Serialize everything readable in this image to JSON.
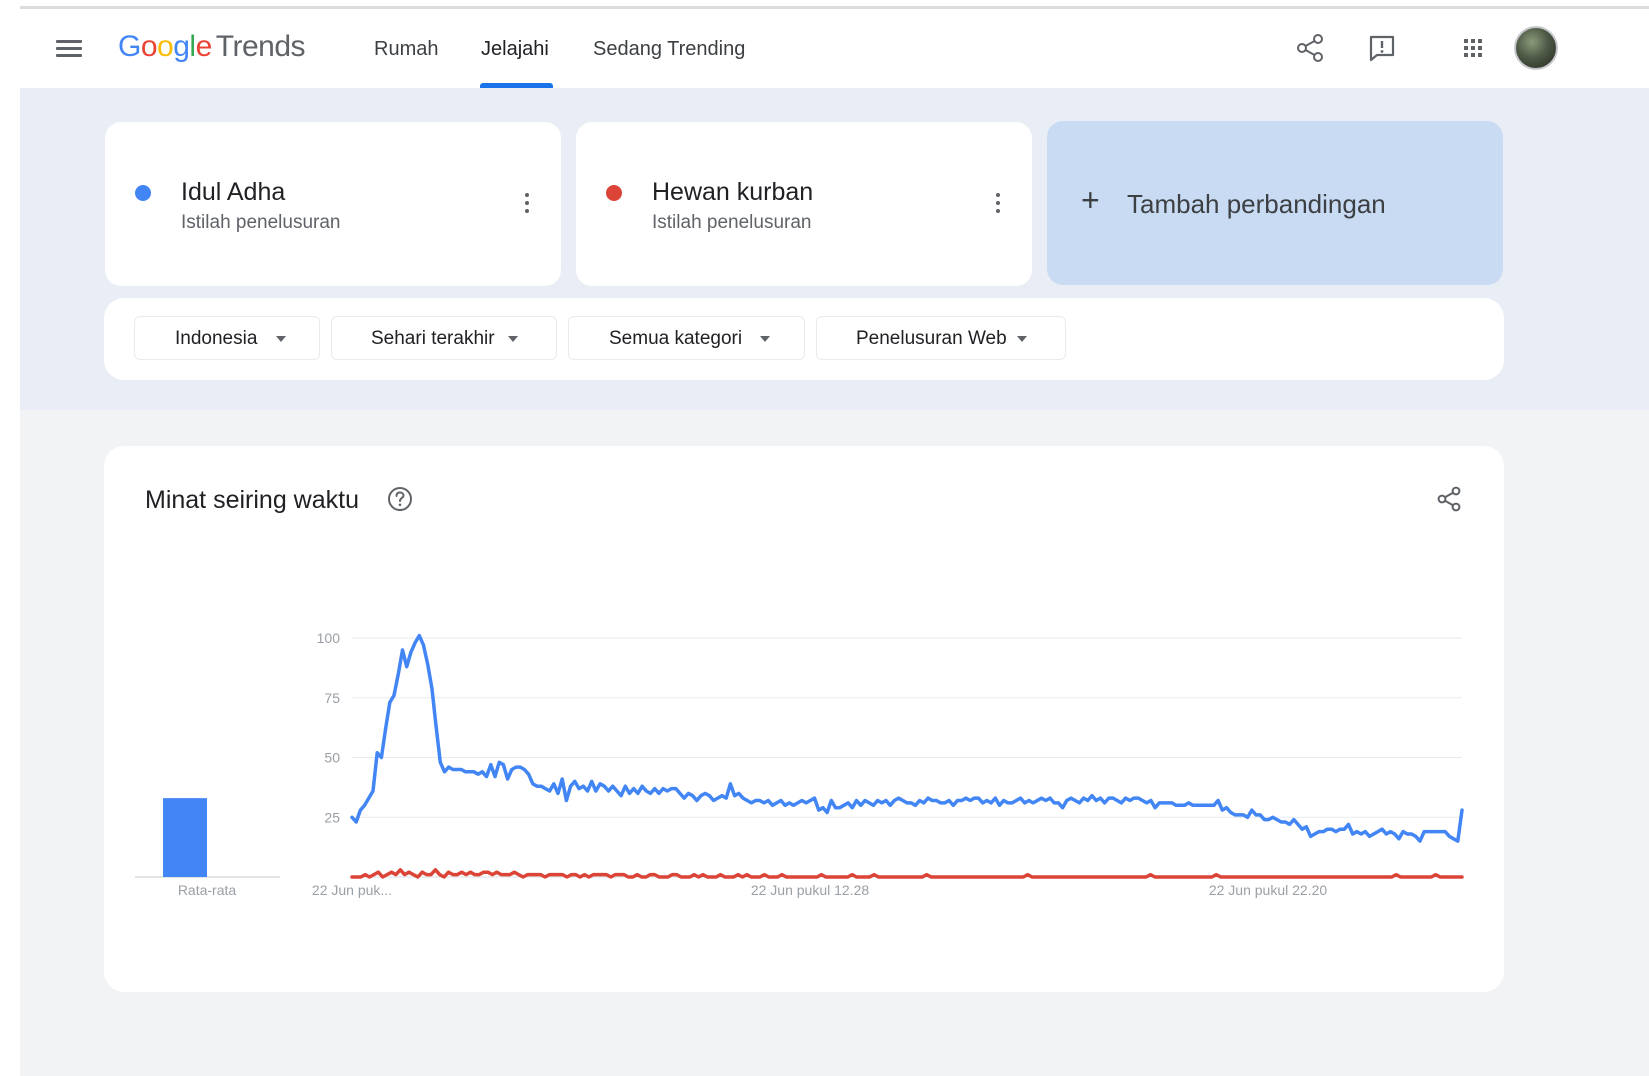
{
  "header": {
    "logo": {
      "google": [
        "G",
        "o",
        "o",
        "g",
        "l",
        "e"
      ],
      "trends": "Trends"
    },
    "nav": [
      {
        "label": "Rumah",
        "active": false
      },
      {
        "label": "Jelajahi",
        "active": true
      },
      {
        "label": "Sedang Trending",
        "active": false
      }
    ],
    "icons": [
      "menu-icon",
      "share-icon",
      "feedback-icon",
      "apps-grid-icon",
      "avatar"
    ]
  },
  "terms": [
    {
      "label": "Idul Adha",
      "sub": "Istilah penelusuran",
      "color": "#4285f4"
    },
    {
      "label": "Hewan kurban",
      "sub": "Istilah penelusuran",
      "color": "#db4437"
    }
  ],
  "add_compare": {
    "label": "Tambah perbandingan"
  },
  "filters": {
    "region": "Indonesia",
    "time": "Sehari terakhir",
    "category": "Semua kategori",
    "source": "Penelusuran Web"
  },
  "chart_card": {
    "title": "Minat seiring waktu"
  },
  "chart_data": [
    {
      "type": "bar",
      "categories": [
        "Rata-rata"
      ],
      "series": [
        {
          "name": "Idul Adha",
          "color": "#4285f4",
          "values": [
            33
          ]
        },
        {
          "name": "Hewan kurban",
          "color": "#db4437",
          "values": [
            0
          ]
        }
      ]
    },
    {
      "type": "line",
      "ylim": [
        0,
        100
      ],
      "yticks": [
        25,
        50,
        75,
        100
      ],
      "grid": true,
      "xtick_labels": [
        "22 Jun puk...",
        "22 Jun pukul 12.28",
        "22 Jun pukul 22.20"
      ],
      "series": [
        {
          "name": "Idul Adha",
          "color": "#4285f4",
          "values": [
            25,
            23,
            28,
            30,
            33,
            36,
            52,
            50,
            62,
            73,
            76,
            85,
            95,
            88,
            94,
            98,
            101,
            97,
            89,
            79,
            63,
            48,
            44,
            46,
            45,
            45,
            45,
            44,
            44,
            44,
            43,
            44,
            42,
            47,
            42,
            48,
            47,
            41,
            45,
            46,
            46,
            45,
            43,
            39,
            38,
            38,
            37,
            36,
            39,
            35,
            41,
            32,
            38,
            40,
            37,
            38,
            36,
            40,
            36,
            39,
            38,
            36,
            38,
            36,
            34,
            38,
            35,
            37,
            35,
            38,
            36,
            35,
            37,
            35,
            37,
            36,
            37,
            37,
            35,
            33,
            35,
            34,
            32,
            34,
            35,
            34,
            32,
            33,
            34,
            33,
            39,
            34,
            35,
            33,
            32,
            31,
            32,
            32,
            31,
            32,
            30,
            31,
            32,
            30,
            31,
            30,
            31,
            32,
            31,
            32,
            33,
            28,
            29,
            27,
            32,
            29,
            29,
            30,
            31,
            29,
            32,
            30,
            32,
            31,
            30,
            32,
            31,
            32,
            30,
            32,
            33,
            32,
            31,
            31,
            30,
            32,
            31,
            33,
            32,
            32,
            31,
            31,
            32,
            30,
            32,
            32,
            33,
            32,
            33,
            33,
            31,
            32,
            31,
            33,
            30,
            32,
            31,
            31,
            32,
            33,
            31,
            32,
            31,
            32,
            33,
            32,
            33,
            31,
            31,
            29,
            32,
            33,
            32,
            31,
            33,
            32,
            34,
            32,
            33,
            31,
            33,
            33,
            32,
            31,
            33,
            32,
            33,
            33,
            32,
            31,
            32,
            29,
            31,
            31,
            31,
            31,
            30,
            30,
            30,
            31,
            30,
            30,
            30,
            30,
            30,
            30,
            32,
            28,
            29,
            27,
            26,
            26,
            26,
            25,
            28,
            26,
            26,
            24,
            24,
            25,
            24,
            23,
            23,
            22,
            24,
            22,
            20,
            21,
            17,
            18,
            19,
            19,
            20,
            20,
            19,
            20,
            20,
            22,
            18,
            19,
            18,
            19,
            17,
            18,
            19,
            20,
            18,
            19,
            18,
            16,
            19,
            18,
            18,
            17,
            15,
            19,
            19,
            19,
            19,
            19,
            19,
            17,
            16,
            15,
            28
          ]
        },
        {
          "name": "Hewan kurban",
          "color": "#db4437",
          "values": [
            0,
            0,
            0,
            1,
            0,
            1,
            2,
            0,
            1,
            2,
            1,
            3,
            1,
            2,
            1,
            0,
            2,
            1,
            1,
            3,
            1,
            0,
            2,
            1,
            1,
            2,
            1,
            2,
            1,
            1,
            2,
            2,
            1,
            2,
            1,
            1,
            1,
            2,
            1,
            0,
            1,
            1,
            1,
            1,
            0,
            1,
            1,
            1,
            1,
            0,
            1,
            1,
            0,
            1,
            0,
            1,
            1,
            1,
            1,
            0,
            1,
            1,
            1,
            0,
            0,
            1,
            0,
            0,
            1,
            1,
            0,
            0,
            0,
            1,
            1,
            0,
            0,
            0,
            1,
            0,
            1,
            0,
            0,
            0,
            1,
            0,
            0,
            0,
            1,
            0,
            1,
            0,
            0,
            0,
            1,
            0,
            0,
            0,
            1,
            0,
            0,
            0,
            0,
            0,
            0,
            0,
            0,
            1,
            0,
            0,
            0,
            0,
            0,
            0,
            1,
            0,
            0,
            0,
            0,
            1,
            0,
            0,
            0,
            0,
            0,
            0,
            0,
            0,
            0,
            0,
            0,
            1,
            0,
            0,
            0,
            0,
            0,
            0,
            0,
            0,
            0,
            0,
            0,
            0,
            0,
            0,
            0,
            0,
            0,
            0,
            0,
            0,
            0,
            0,
            1,
            0,
            0,
            0,
            0,
            0,
            0,
            0,
            0,
            0,
            0,
            0,
            0,
            0,
            0,
            0,
            0,
            0,
            0,
            0,
            0,
            0,
            0,
            0,
            0,
            0,
            0,
            0,
            1,
            0,
            0,
            0,
            0,
            0,
            0,
            0,
            0,
            0,
            0,
            0,
            0,
            0,
            0,
            1,
            0,
            0,
            0,
            0,
            0,
            0,
            0,
            0,
            0,
            0,
            0,
            0,
            0,
            0,
            0,
            0,
            0,
            0,
            0,
            0,
            0,
            0,
            0,
            0,
            0,
            0,
            0,
            0,
            0,
            0,
            0,
            0,
            0,
            0,
            0,
            0,
            0,
            0,
            0,
            0,
            1,
            0,
            0,
            0,
            0,
            0,
            0,
            0,
            0,
            1,
            0,
            0,
            0,
            0,
            0,
            0
          ]
        }
      ]
    }
  ]
}
